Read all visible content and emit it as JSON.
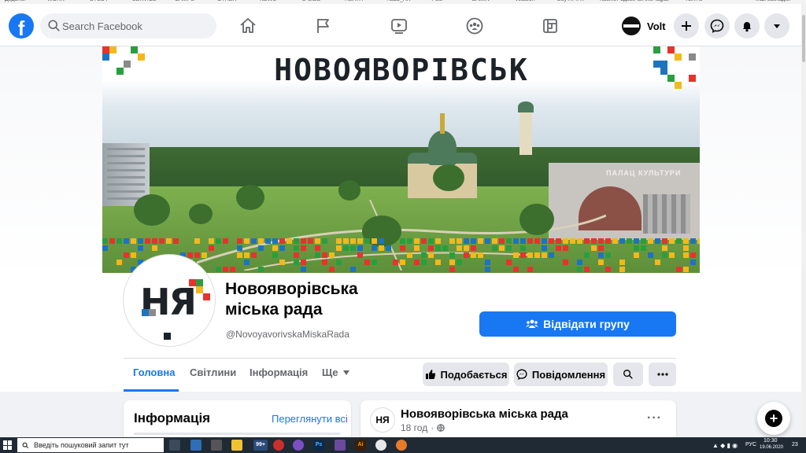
{
  "browser": {
    "bookmarks": [
      "Додатки",
      "WORK",
      "STUDY",
      "SERVICE",
      "CAMPS",
      "OTHER",
      "NEWS",
      "B-SIDE",
      "НЕАТН",
      "Nazz_AR",
      "-PSS",
      "ZAMIN",
      "Vodafon",
      "Buy ATTA!!",
      "Кабінет вдовича",
      "AntiPlagiat",
      "TEXTS",
      "Інші закладки"
    ]
  },
  "topbar": {
    "logo_letter": "f",
    "search_placeholder": "Search Facebook",
    "nav_icons": [
      "home-icon",
      "flag-icon",
      "watch-icon",
      "groups-icon",
      "gaming-icon"
    ],
    "profile_name": "Volt",
    "right_icons": [
      "plus-icon",
      "messenger-icon",
      "bell-icon",
      "caret-down-icon"
    ]
  },
  "cover": {
    "city_name": "НОВОЯВОРІВСЬК",
    "hall_sign": "ПАЛАЦ КУЛЬТУРИ",
    "pixel_colors": [
      "#e8322e",
      "#f2b81c",
      "#2a9e3f",
      "#1e73be",
      "#8a8a8a",
      "#1c2228"
    ]
  },
  "page": {
    "avatar_logo": "НЯ",
    "name_line1": "Новояворівська",
    "name_line2": "міська рада",
    "handle": "@NovoyavorivskaMiskaRada",
    "visit_group_label": "Відвідати групу"
  },
  "tabs": [
    {
      "label": "Головна",
      "active": true
    },
    {
      "label": "Світлини",
      "active": false
    },
    {
      "label": "Інформація",
      "active": false
    },
    {
      "label": "Ще",
      "active": false
    }
  ],
  "actions": {
    "like_label": "Подобається",
    "message_label": "Повідомлення"
  },
  "info_card": {
    "title": "Інформація",
    "link": "Переглянути всі"
  },
  "post": {
    "author": "Новояворівська міська рада",
    "avatar_logo": "НЯ",
    "time": "18 год",
    "more": "···"
  },
  "taskbar": {
    "search_placeholder": "Введіть пошуковий запит тут",
    "badge": "99+",
    "language": "РУС",
    "time": "10:30",
    "date": "19.06.2020",
    "notifications": "23"
  },
  "colors": {
    "fb_blue": "#1877f2",
    "background": "#f0f2f5",
    "button_gray": "#e4e6eb",
    "taskbar": "#1f2a35"
  }
}
